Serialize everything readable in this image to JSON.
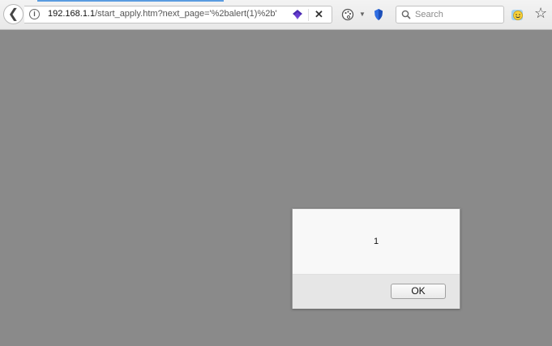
{
  "browser": {
    "url_host": "192.168.1.1",
    "url_path": "/start_apply.htm?next_page='%2balert(1)%2b'",
    "search_placeholder": "Search",
    "icons": {
      "back": "back-arrow-icon",
      "info": "info-icon",
      "extension": "purple-layers-icon",
      "close": "close-icon",
      "palette": "palette-icon",
      "dropdown": "chevron-down-icon",
      "shield": "blue-shield-icon",
      "search": "search-icon",
      "emoji": "emoji-icon",
      "bookmark": "star-icon"
    }
  },
  "dialog": {
    "message": "1",
    "ok_label": "OK"
  },
  "colors": {
    "page_overlay": "#8a8a8a",
    "tab_accent": "#5a9be0"
  }
}
